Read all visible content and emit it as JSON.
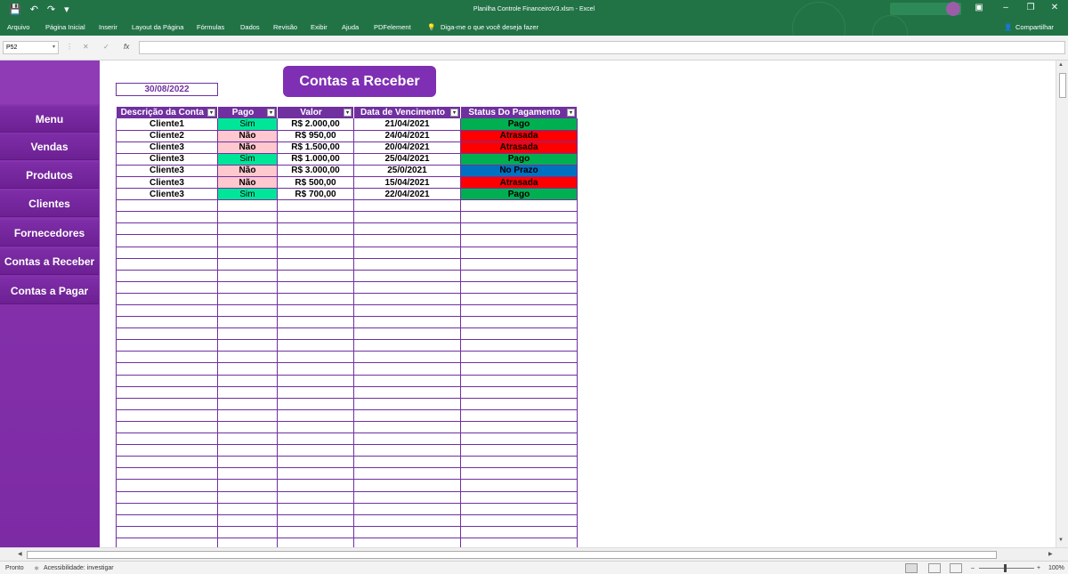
{
  "window": {
    "title": "Planilha Controle FinanceiroV3.xlsm  -  Excel",
    "share_label": "Compartilhar"
  },
  "menu": [
    "Arquivo",
    "Página Inicial",
    "Inserir",
    "Layout da Página",
    "Fórmulas",
    "Dados",
    "Revisão",
    "Exibir",
    "Ajuda",
    "PDFelement",
    "Diga-me o que você deseja fazer"
  ],
  "formula_bar": {
    "name_box": "P52",
    "formula": ""
  },
  "sidebar": {
    "items": [
      "Menu",
      "Vendas",
      "Produtos",
      "Clientes",
      "Fornecedores",
      "Contas a Receber",
      "Contas a Pagar"
    ]
  },
  "sheet": {
    "date": "30/08/2022",
    "title": "Contas a Receber",
    "headers": [
      "Descrição da Conta",
      "Pago",
      "Valor",
      "Data de Vencimento",
      "Status Do Pagamento"
    ],
    "rows": [
      [
        "Cliente1",
        "Sim",
        "R$ 2.000,00",
        "21/04/2021",
        "Pago"
      ],
      [
        "Cliente2",
        "Não",
        "R$ 950,00",
        "24/04/2021",
        "Atrasada"
      ],
      [
        "Cliente3",
        "Não",
        "R$ 1.500,00",
        "20/04/2021",
        "Atrasada"
      ],
      [
        "Cliente3",
        "Sim",
        "R$ 1.000,00",
        "25/04/2021",
        "Pago"
      ],
      [
        "Cliente3",
        "Não",
        "R$ 3.000,00",
        "25/0/2021",
        "No Prazo"
      ],
      [
        "Cliente3",
        "Não",
        "R$ 500,00",
        "15/04/2021",
        "Atrasada"
      ],
      [
        "Cliente3",
        "Sim",
        "R$ 700,00",
        "22/04/2021",
        "Pago"
      ]
    ],
    "empty_rows": 30
  },
  "status": {
    "ready": "Pronto",
    "accessibility": "Acessibilidade: investigar",
    "zoom": "100%"
  },
  "colors": {
    "excel_green": "#217346",
    "sidebar_purple": "#7d2aa5",
    "header_purple": "#7030a0",
    "status_paid": "#00b050",
    "status_late": "#ff0000",
    "status_ontime": "#0070c0"
  }
}
